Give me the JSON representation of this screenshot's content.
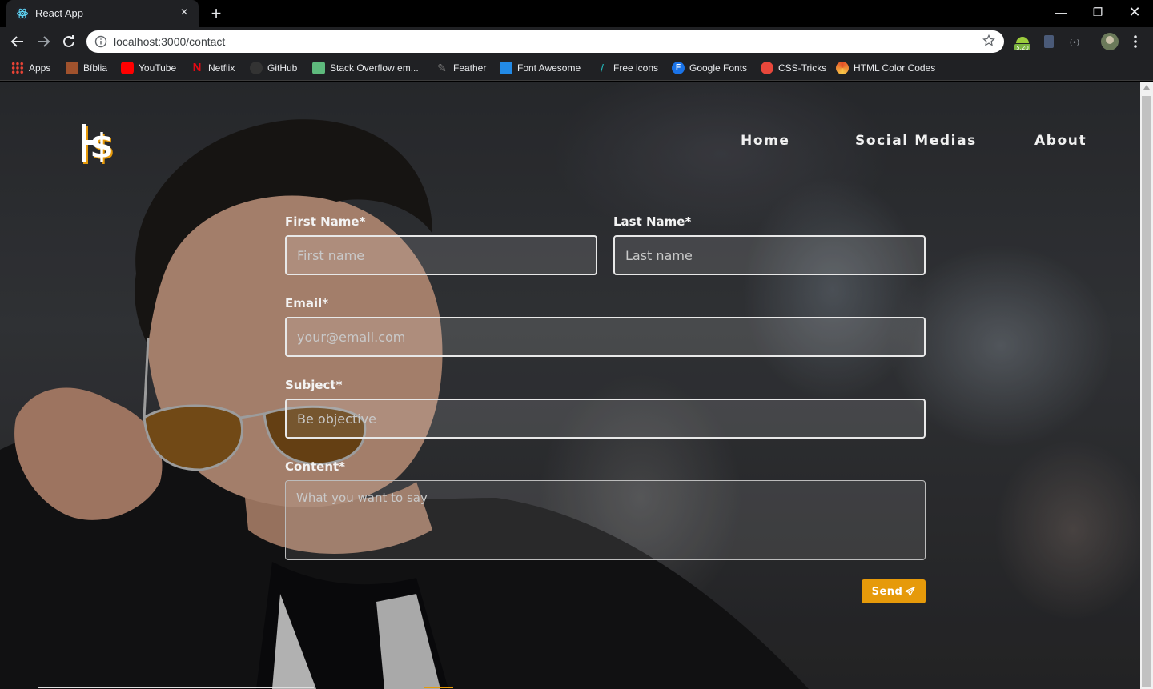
{
  "browser": {
    "tab_title": "React App",
    "url": "localhost:3000/contact",
    "extension_badge": "5.20"
  },
  "bookmarks": [
    {
      "label": "Apps",
      "color": "#f2a33a"
    },
    {
      "label": "Bíblia",
      "color": "#a0522d"
    },
    {
      "label": "YouTube",
      "color": "#ff0000"
    },
    {
      "label": "Netflix",
      "color": "#e50914"
    },
    {
      "label": "GitHub",
      "color": "#333333"
    },
    {
      "label": "Stack Overflow em...",
      "color": "#5eba7d"
    },
    {
      "label": "Feather",
      "color": "#555555"
    },
    {
      "label": "Font Awesome",
      "color": "#228ae6"
    },
    {
      "label": "Free icons",
      "color": "#22c1c3"
    },
    {
      "label": "Google Fonts",
      "color": "#1a73e8"
    },
    {
      "label": "CSS-Tricks",
      "color": "#e8473b"
    },
    {
      "label": "HTML Color Codes",
      "color": "#e44d26"
    }
  ],
  "nav": {
    "home": "Home",
    "social": "Social Medias",
    "about": "About"
  },
  "form": {
    "first_name_label": "First Name*",
    "first_name_placeholder": "First name",
    "last_name_label": "Last Name*",
    "last_name_placeholder": "Last name",
    "email_label": "Email*",
    "email_placeholder": "your@email.com",
    "subject_label": "Subject*",
    "subject_placeholder": "Be objective",
    "content_label": "Content*",
    "content_placeholder": "What you want to say",
    "send_label": "Send"
  },
  "colors": {
    "accent": "#e69a0a"
  }
}
